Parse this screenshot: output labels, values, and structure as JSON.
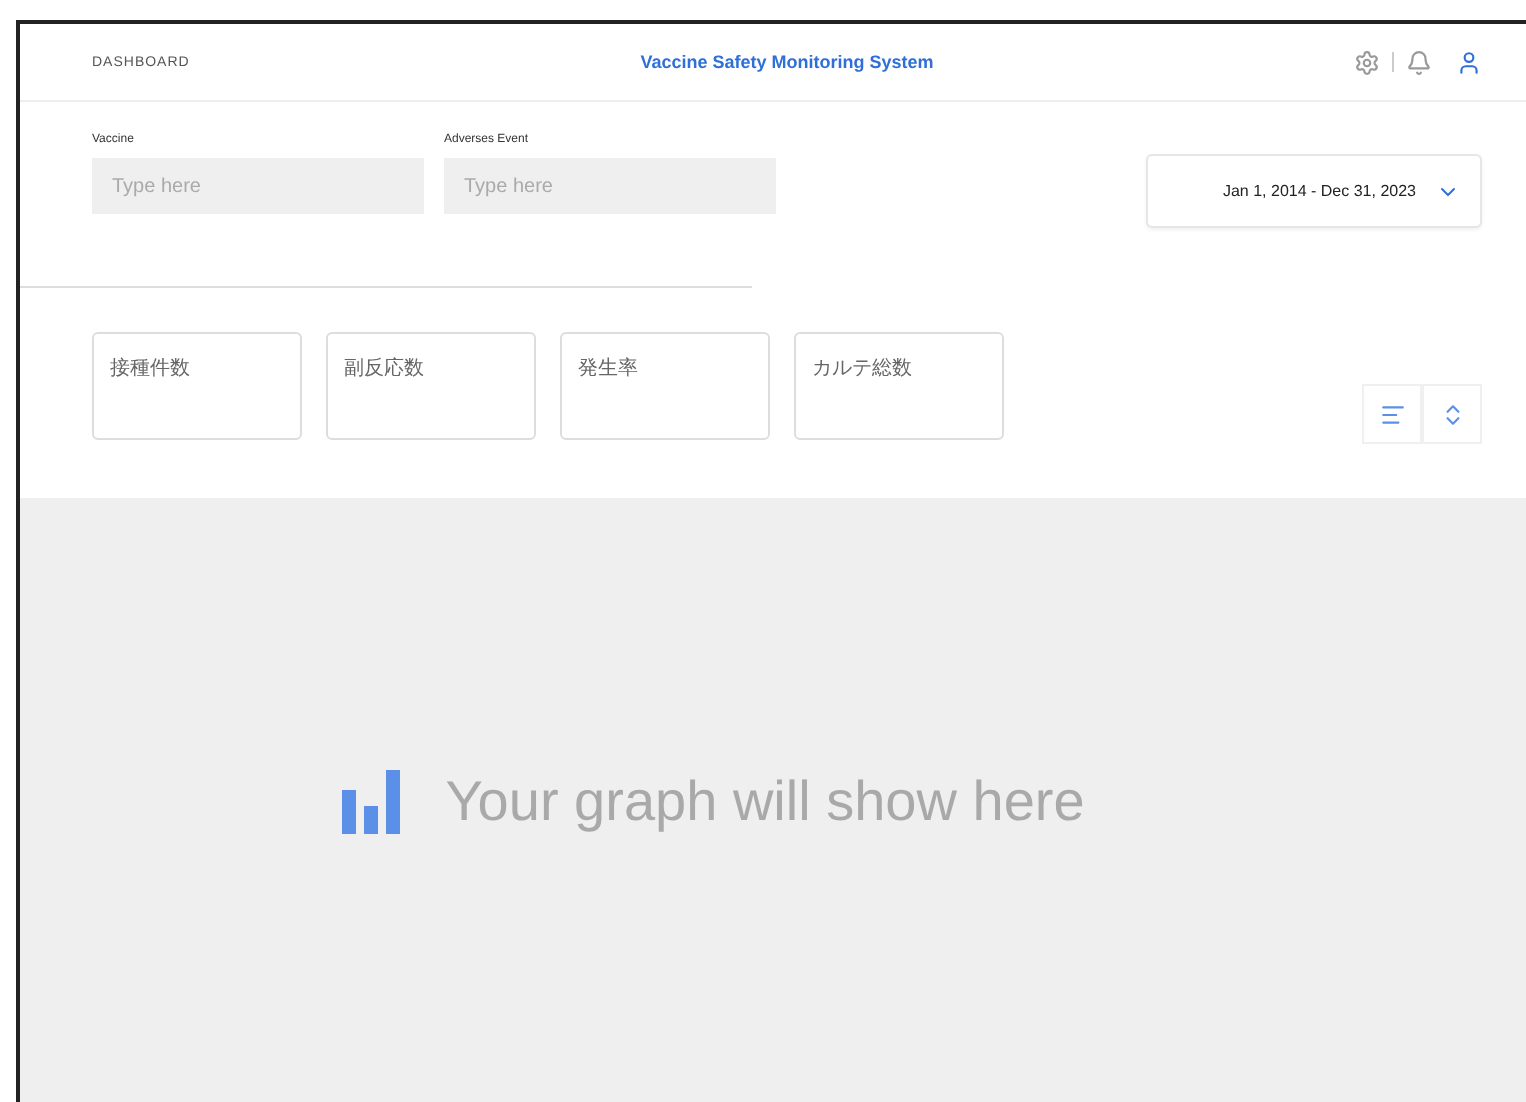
{
  "header": {
    "breadcrumb": "DASHBOARD",
    "title": "Vaccine Safety Monitoring System"
  },
  "filters": [
    {
      "label": "Vaccine",
      "placeholder": "Type here"
    },
    {
      "label": "Adverses Event",
      "placeholder": "Type here"
    }
  ],
  "date_range": {
    "value": "Jan 1, 2014 - Dec 31, 2023"
  },
  "stat_cards": [
    {
      "label": "接種件数"
    },
    {
      "label": "副反応数"
    },
    {
      "label": "発生率"
    },
    {
      "label": "カルテ総数"
    }
  ],
  "view_toggles": [
    {
      "kind": "list",
      "selected": false
    },
    {
      "kind": "collapse",
      "selected": false
    }
  ],
  "graph_area": {
    "message": "Your graph will show here"
  }
}
